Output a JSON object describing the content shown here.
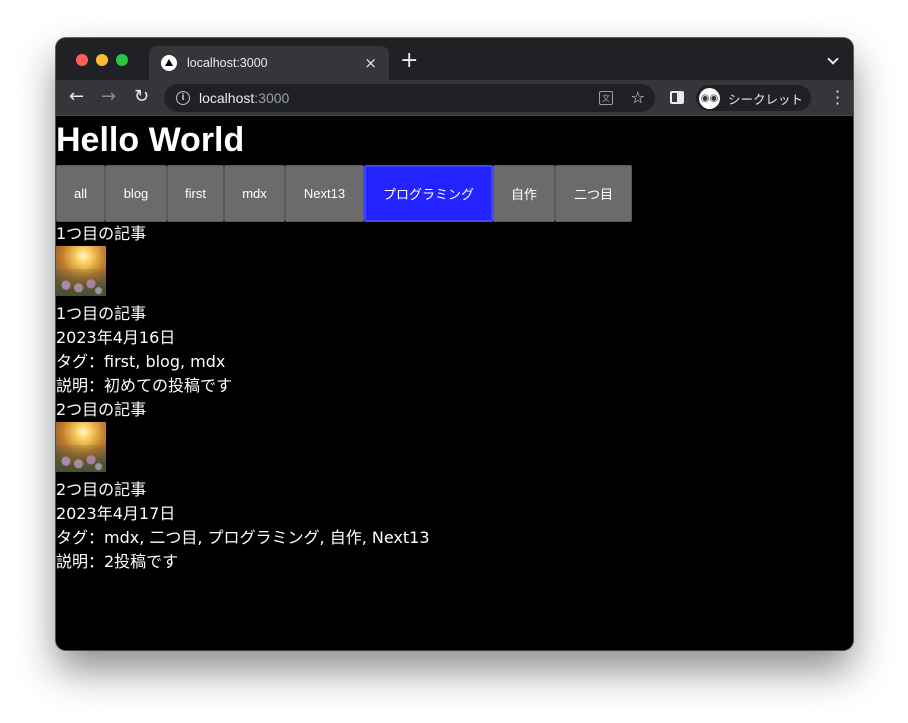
{
  "browser": {
    "tab_title": "localhost:3000",
    "tab_close": "×",
    "new_tab": "+",
    "url_host": "localhost",
    "url_port": ":3000",
    "profile_label": "シークレット"
  },
  "page": {
    "title": "Hello World",
    "tags": [
      "all",
      "blog",
      "first",
      "mdx",
      "Next13",
      "プログラミング",
      "自作",
      "二つ目"
    ],
    "active_tag": "プログラミング",
    "posts": [
      {
        "heading": "1つ目の記事",
        "title": "1つ目の記事",
        "date": "2023年4月16日",
        "tags_line": "タグ：first, blog, mdx",
        "description": "説明：初めての投稿です"
      },
      {
        "heading": "2つ目の記事",
        "title": "2つ目の記事",
        "date": "2023年4月17日",
        "tags_line": "タグ：mdx, 二つ目, プログラミング, 自作, Next13",
        "description": "説明：2投稿です"
      }
    ]
  },
  "colors": {
    "tag_button": "#6b6b6b",
    "tag_active": "#2323ff",
    "page_background": "#000000",
    "text": "#ffffff"
  }
}
